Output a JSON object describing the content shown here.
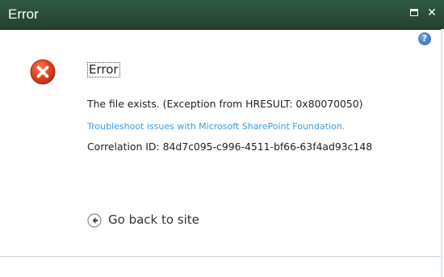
{
  "window": {
    "title": "Error",
    "maximize_icon": "maximize-icon",
    "close_icon": "close-icon",
    "close_glyph": "✕"
  },
  "help": {
    "icon": "help-icon",
    "glyph": "?"
  },
  "content": {
    "error_icon": "error-icon",
    "heading": "Error",
    "message": "The file exists. (Exception from HRESULT: 0x80070050)",
    "troubleshoot_link": "Troubleshoot issues with Microsoft SharePoint Foundation.",
    "correlation": "Correlation ID: 84d7c095-c996-4511-bf66-63f4ad93c148",
    "go_back_label": "Go back to site",
    "go_back_icon": "back-arrow-icon"
  },
  "colors": {
    "titlebar": "#2b4f3a",
    "link": "#3a9be0",
    "error_red": "#d9381e"
  }
}
